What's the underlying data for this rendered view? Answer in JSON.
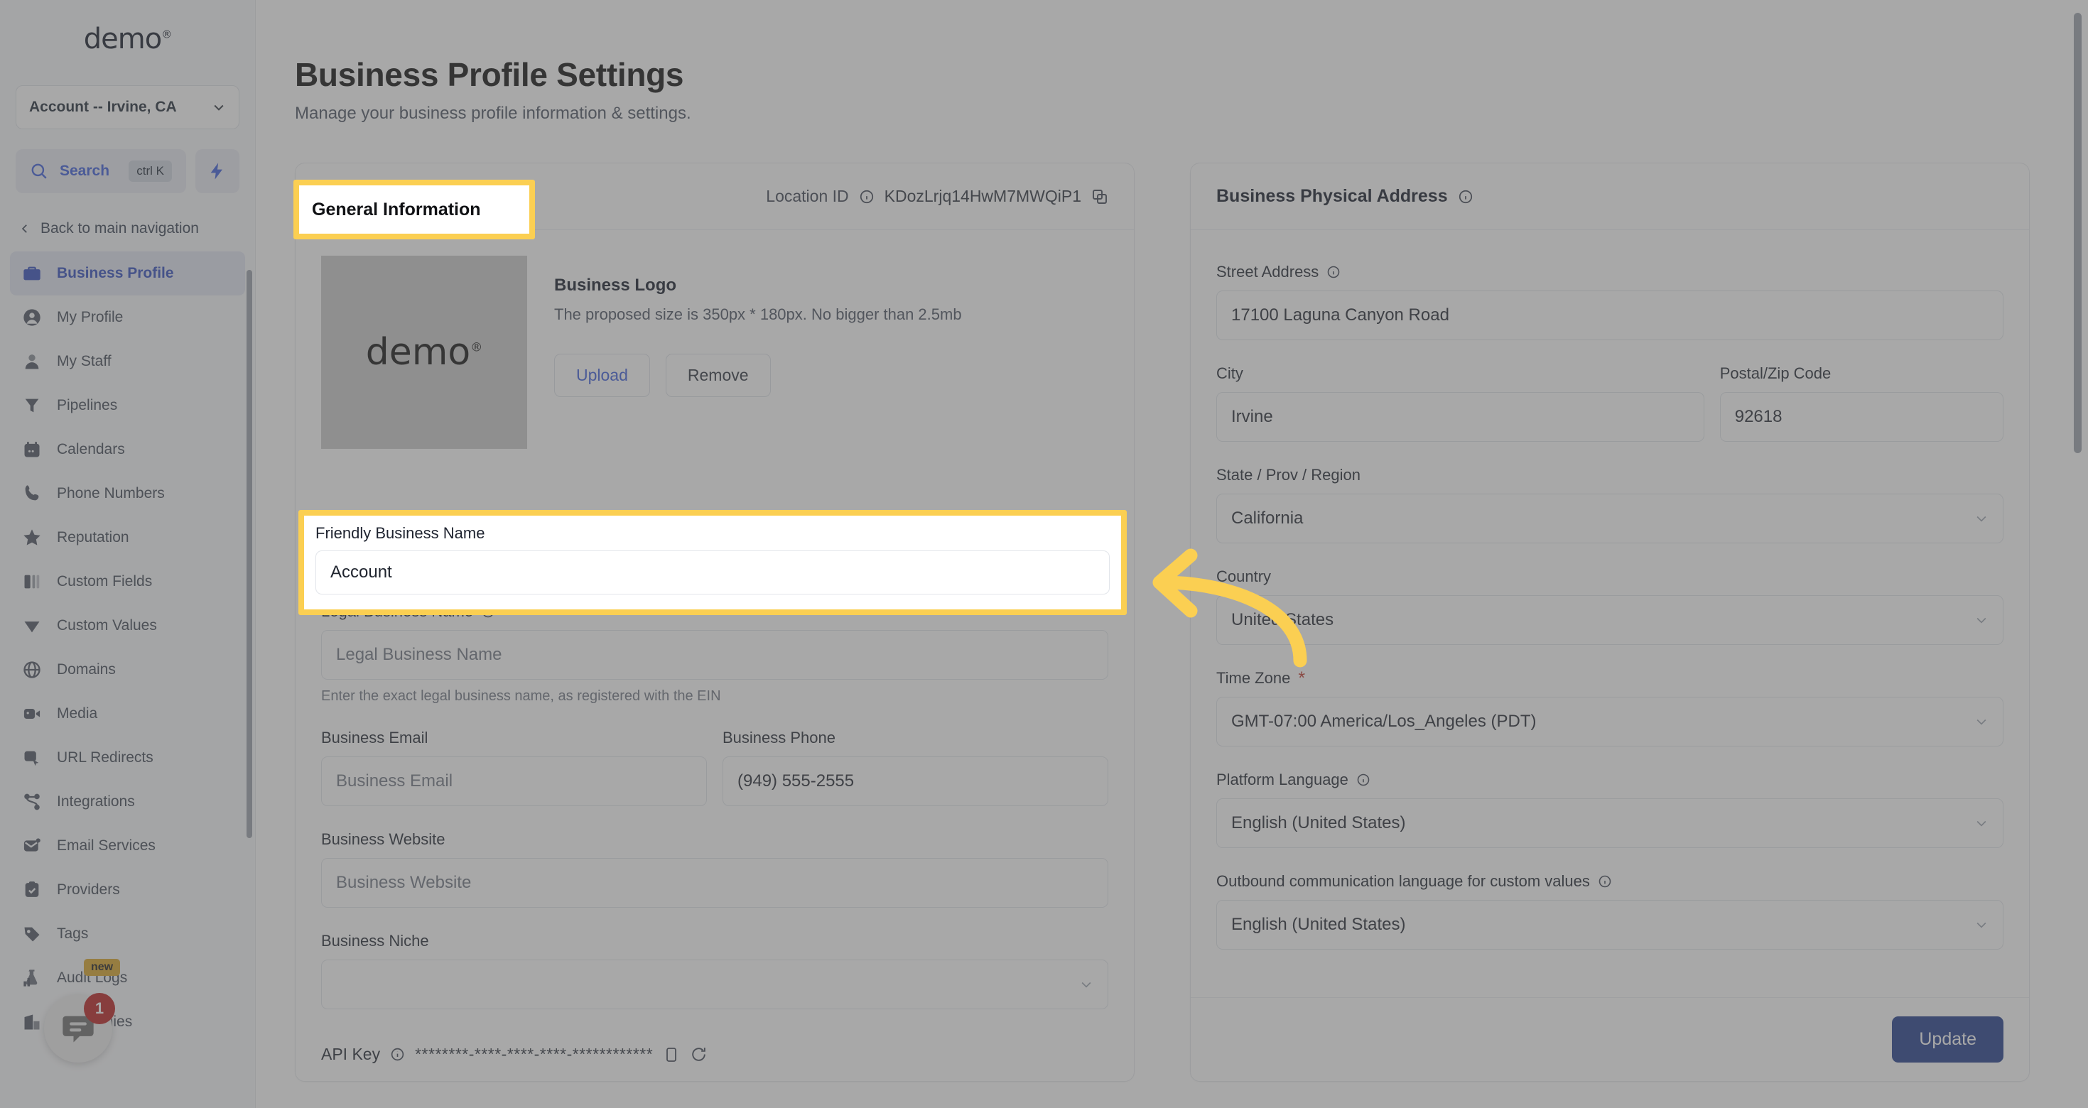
{
  "sidebar": {
    "brand": "demo",
    "account_selector": {
      "value": "Account -- Irvine, CA",
      "icon": "chevron-down-icon"
    },
    "search": {
      "label": "Search",
      "shortcut": "ctrl K",
      "icon": "search-icon"
    },
    "quick_action_icon": "lightning-bolt-icon",
    "back_nav": {
      "label": "Back to main navigation",
      "icon": "chevron-left-icon"
    },
    "items": [
      {
        "label": "Business Profile",
        "icon": "briefcase-icon",
        "active": true
      },
      {
        "label": "My Profile",
        "icon": "user-circle-icon",
        "active": false
      },
      {
        "label": "My Staff",
        "icon": "user-icon",
        "active": false
      },
      {
        "label": "Pipelines",
        "icon": "funnel-icon",
        "active": false
      },
      {
        "label": "Calendars",
        "icon": "calendar-icon",
        "active": false
      },
      {
        "label": "Phone Numbers",
        "icon": "phone-icon",
        "active": false
      },
      {
        "label": "Reputation",
        "icon": "star-icon",
        "active": false
      },
      {
        "label": "Custom Fields",
        "icon": "columns-icon",
        "active": false
      },
      {
        "label": "Custom Values",
        "icon": "diamond-icon",
        "active": false
      },
      {
        "label": "Domains",
        "icon": "globe-icon",
        "active": false
      },
      {
        "label": "Media",
        "icon": "video-icon",
        "active": false
      },
      {
        "label": "URL Redirects",
        "icon": "redirect-icon",
        "active": false
      },
      {
        "label": "Integrations",
        "icon": "share-nodes-icon",
        "active": false
      },
      {
        "label": "Email Services",
        "icon": "envelope-icon",
        "active": false
      },
      {
        "label": "Providers",
        "icon": "clipboard-check-icon",
        "active": false
      },
      {
        "label": "Tags",
        "icon": "tag-icon",
        "active": false
      },
      {
        "label": "Audit Logs",
        "icon": "flask-chart-icon",
        "active": false,
        "badge": "new"
      },
      {
        "label": "Companies",
        "icon": "building-icon",
        "active": false
      }
    ],
    "chat_widget": {
      "icon": "chat-bubble-icon",
      "unread_count": "1"
    }
  },
  "header": {
    "title": "Business Profile Settings",
    "subtitle": "Manage your business profile information & settings."
  },
  "general_information": {
    "tab_label": "General Information",
    "location_id_label": "Location ID",
    "location_id_info_icon": "info-icon",
    "location_id_value": "KDozLrjq14HwM7MWQiP1",
    "copy_icon": "copy-icon",
    "logo": {
      "thumb_text": "demo",
      "title": "Business Logo",
      "description": "The proposed size is 350px * 180px. No bigger than 2.5mb",
      "upload_label": "Upload",
      "remove_label": "Remove"
    },
    "friendly_business_name": {
      "label": "Friendly Business Name",
      "value": "Account"
    },
    "legal_business_name": {
      "label": "Legal Business Name",
      "info_icon": "info-icon",
      "placeholder": "Legal Business Name",
      "hint": "Enter the exact legal business name, as registered with the EIN"
    },
    "business_email": {
      "label": "Business Email",
      "placeholder": "Business Email"
    },
    "business_phone": {
      "label": "Business Phone",
      "value": "(949) 555-2555"
    },
    "business_website": {
      "label": "Business Website",
      "placeholder": "Business Website"
    },
    "business_niche": {
      "label": "Business Niche",
      "value": "",
      "icon": "chevron-down-icon"
    },
    "api_key": {
      "label": "API Key",
      "info_icon": "info-icon",
      "value": "********-****-****-****-************",
      "copy_icon": "copy-icon",
      "refresh_icon": "refresh-icon"
    }
  },
  "physical_address": {
    "title": "Business Physical Address",
    "info_icon": "info-icon",
    "street": {
      "label": "Street Address",
      "info_icon": "info-icon",
      "value": "17100 Laguna Canyon Road"
    },
    "city": {
      "label": "City",
      "value": "Irvine"
    },
    "postal": {
      "label": "Postal/Zip Code",
      "value": "92618"
    },
    "state": {
      "label": "State / Prov / Region",
      "value": "California",
      "icon": "chevron-down-icon"
    },
    "country": {
      "label": "Country",
      "value": "United States",
      "icon": "chevron-down-icon"
    },
    "timezone": {
      "label": "Time Zone",
      "required": "*",
      "value": "GMT-07:00 America/Los_Angeles (PDT)",
      "icon": "chevron-down-icon"
    },
    "platform_language": {
      "label": "Platform Language",
      "info_icon": "info-icon",
      "value": "English (United States)",
      "icon": "chevron-down-icon"
    },
    "outbound_language": {
      "label": "Outbound communication language for custom values",
      "info_icon": "info-icon",
      "value": "English (United States)",
      "icon": "chevron-down-icon"
    },
    "update_label": "Update"
  },
  "annotations": {
    "highlight_color": "#fbcf52",
    "arrow_icon": "curved-left-arrow-annotation"
  }
}
